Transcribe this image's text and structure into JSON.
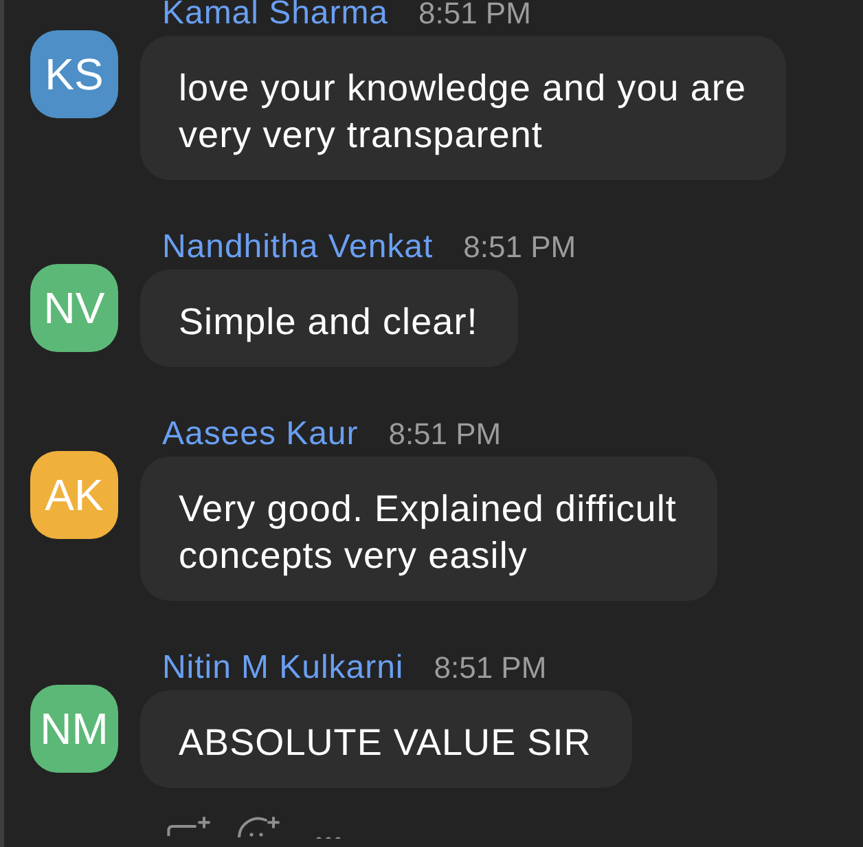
{
  "messages": [
    {
      "sender": "Kamal Sharma",
      "time": "8:51 PM",
      "avatar": {
        "initials": "KS",
        "color": "#4d8fc6"
      },
      "text": "love your knowledge and you are very very transparent"
    },
    {
      "sender": "Nandhitha Venkat",
      "time": "8:51 PM",
      "avatar": {
        "initials": "NV",
        "color": "#5cb877"
      },
      "text": "Simple and clear!"
    },
    {
      "sender": "Aasees Kaur",
      "time": "8:51 PM",
      "avatar": {
        "initials": "AK",
        "color": "#efb03c"
      },
      "text": "Very good. Explained difficult concepts very easily"
    },
    {
      "sender": "Nitin M Kulkarni",
      "time": "8:51 PM",
      "avatar": {
        "initials": "NM",
        "color": "#5cb877"
      },
      "text": "ABSOLUTE VALUE SIR"
    }
  ]
}
